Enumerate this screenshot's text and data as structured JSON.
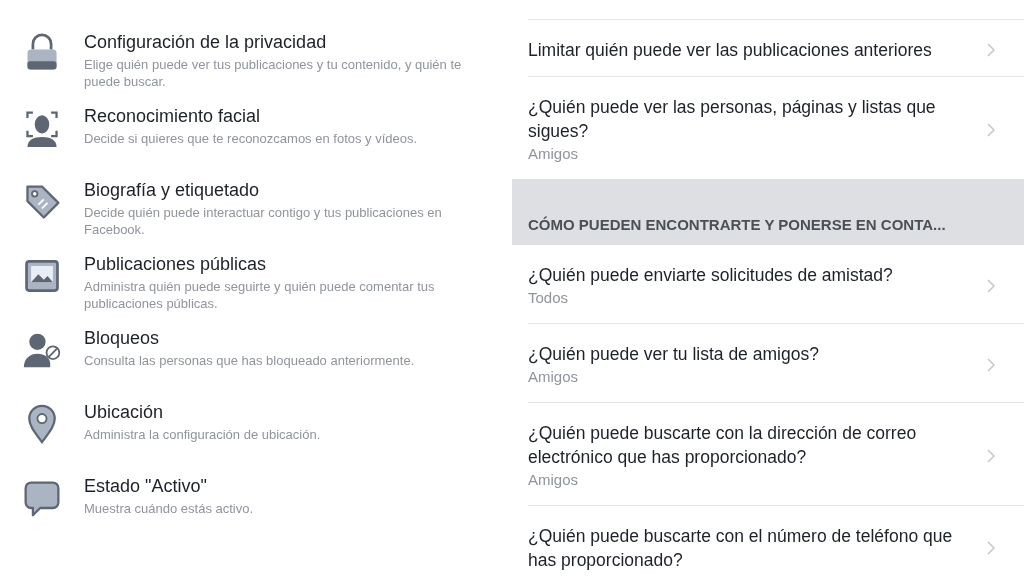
{
  "left_items": [
    {
      "title": "Configuración de la privacidad",
      "description": "Elige quién puede ver tus publicaciones y tu contenido, y quién te puede buscar."
    },
    {
      "title": "Reconocimiento facial",
      "description": "Decide si quieres que te reconozcamos en fotos y vídeos."
    },
    {
      "title": "Biografía y etiquetado",
      "description": "Decide quién puede interactuar contigo y tus publicaciones en Facebook."
    },
    {
      "title": "Publicaciones públicas",
      "description": "Administra quién puede seguirte y quién puede comentar tus publicaciones públicas."
    },
    {
      "title": "Bloqueos",
      "description": "Consulta las personas que has bloqueado anteriormente."
    },
    {
      "title": "Ubicación",
      "description": "Administra la configuración de ubicación."
    },
    {
      "title": "Estado \"Activo\"",
      "description": "Muestra cuándo estás activo."
    }
  ],
  "right_items": [
    {
      "kind": "row",
      "title": "Limitar quién puede ver las publicaciones anteriores"
    },
    {
      "kind": "row",
      "title": "¿Quién puede ver las personas, páginas y listas que sigues?",
      "value": "Amigos"
    },
    {
      "kind": "header",
      "title": "CÓMO PUEDEN ENCONTRARTE Y PONERSE EN CONTA..."
    },
    {
      "kind": "row",
      "title": "¿Quién puede enviarte solicitudes de amistad?",
      "value": "Todos"
    },
    {
      "kind": "row",
      "title": "¿Quién puede ver tu lista de amigos?",
      "value": "Amigos"
    },
    {
      "kind": "row",
      "title": "¿Quién puede buscarte con la dirección de correo electrónico que has proporcionado?",
      "value": "Amigos"
    },
    {
      "kind": "row",
      "title": "¿Quién puede buscarte con el número de teléfono que has proporcionado?"
    }
  ]
}
